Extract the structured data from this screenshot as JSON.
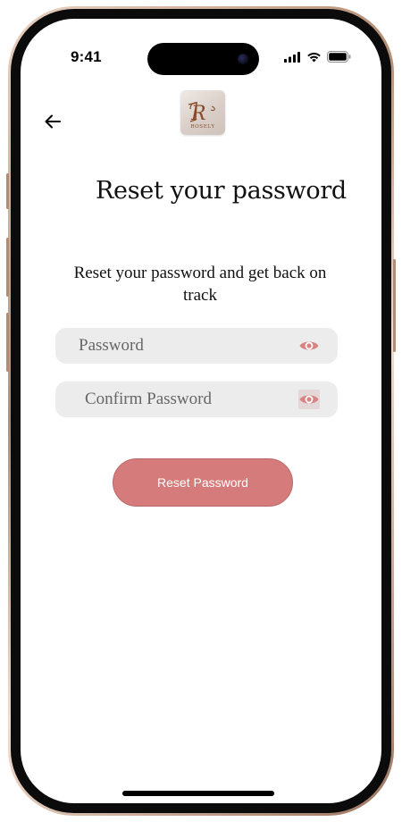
{
  "status_bar": {
    "time": "9:41"
  },
  "brand": {
    "logo_text": "R",
    "logo_subtext": "ROSELY"
  },
  "header": {
    "title": "Reset your password"
  },
  "form": {
    "subtitle": "Reset your password and get back on track",
    "password": {
      "placeholder": "Password",
      "value": ""
    },
    "confirm_password": {
      "placeholder": "Confirm Password",
      "value": ""
    },
    "submit_label": "Reset Password"
  },
  "colors": {
    "accent": "#d57b7b",
    "eye_icon": "#d98283",
    "field_bg": "#ececec"
  },
  "icons": {
    "back": "arrow-left-icon",
    "show_password": "eye-icon",
    "signal": "cellular-signal-icon",
    "wifi": "wifi-icon",
    "battery": "battery-icon"
  }
}
